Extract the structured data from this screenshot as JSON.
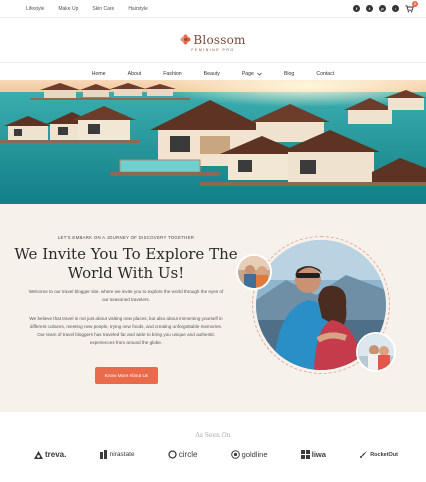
{
  "topbar": {
    "links": [
      "Lifestyle",
      "Make Up",
      "Skin Care",
      "Hairstyle"
    ],
    "social_icons": [
      "facebook-icon",
      "twitter-icon",
      "pinterest-icon",
      "tiktok-icon"
    ],
    "cart_count": "0"
  },
  "logo": {
    "name": "Blossom",
    "tagline": "FEMININE PRO"
  },
  "nav": {
    "items": [
      "Home",
      "About",
      "Fashion",
      "Beauty",
      "Page",
      "Blog",
      "Contact"
    ]
  },
  "intro": {
    "eyebrow": "LET'S EMBARK ON A JOURNEY OF DISCOVERY TOGETHER",
    "headline": "We Invite You To Explore The World With Us!",
    "paragraph1": "Welcome to our travel blogger site, where we invite you to explore the world through the eyes of our seasoned travelers.",
    "paragraph2": "We believe that travel is not just about visiting new places, but also about immersing yourself in different cultures, meeting new people, trying new foods, and creating unforgettable memories. Our team of travel bloggers has traveled far and wide to bring you unique and authentic experiences from around the globe.",
    "cta_label": "Know More About Us"
  },
  "seen_on": {
    "label": "As Seen On",
    "brands": [
      "treva.",
      "nirastate",
      "circle",
      "goldline",
      "liwa",
      "RocketOut"
    ]
  },
  "colors": {
    "accent": "#e96b4c",
    "section_bg": "#f7f1ec",
    "logo": "#7a4a3a"
  }
}
